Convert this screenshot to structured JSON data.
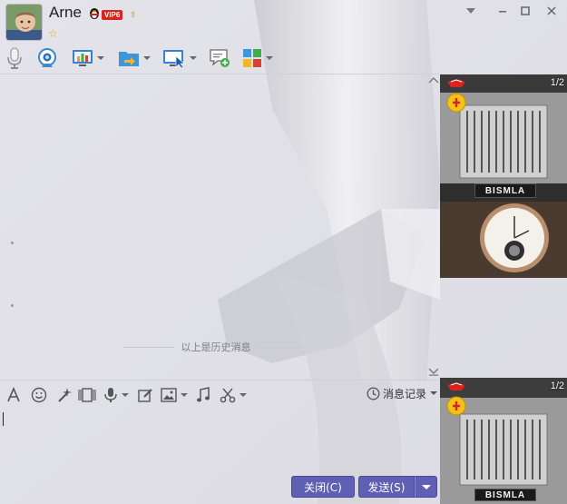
{
  "contact": {
    "name": "Arne",
    "vip_level": "VIP6",
    "vip_arrow": "⇧"
  },
  "window_controls": [
    "chevron-down",
    "minimize",
    "maximize",
    "close"
  ],
  "toolbar_icons": [
    "microphone-icon",
    "webcam-icon",
    "screen-share-icon",
    "file-transfer-icon",
    "remote-desktop-icon",
    "new-chat-icon",
    "apps-icon"
  ],
  "history": {
    "divider_text": "以上是历史消息"
  },
  "input_toolbar": {
    "icons": [
      "font-icon",
      "emoji-icon",
      "magic-wand-icon",
      "video-clip-icon",
      "voice-icon",
      "edit-icon",
      "image-icon",
      "music-icon",
      "scissors-icon"
    ],
    "history_label": "消息记录"
  },
  "buttons": {
    "close_label": "关闭(C)",
    "send_label": "发送(S)"
  },
  "ads": {
    "counter": "1/2",
    "plate_text": "BISMLA"
  },
  "colors": {
    "primary_button": "#5f5fb3",
    "vip_red": "#d8231e",
    "star_gold": "#e0a41c"
  }
}
